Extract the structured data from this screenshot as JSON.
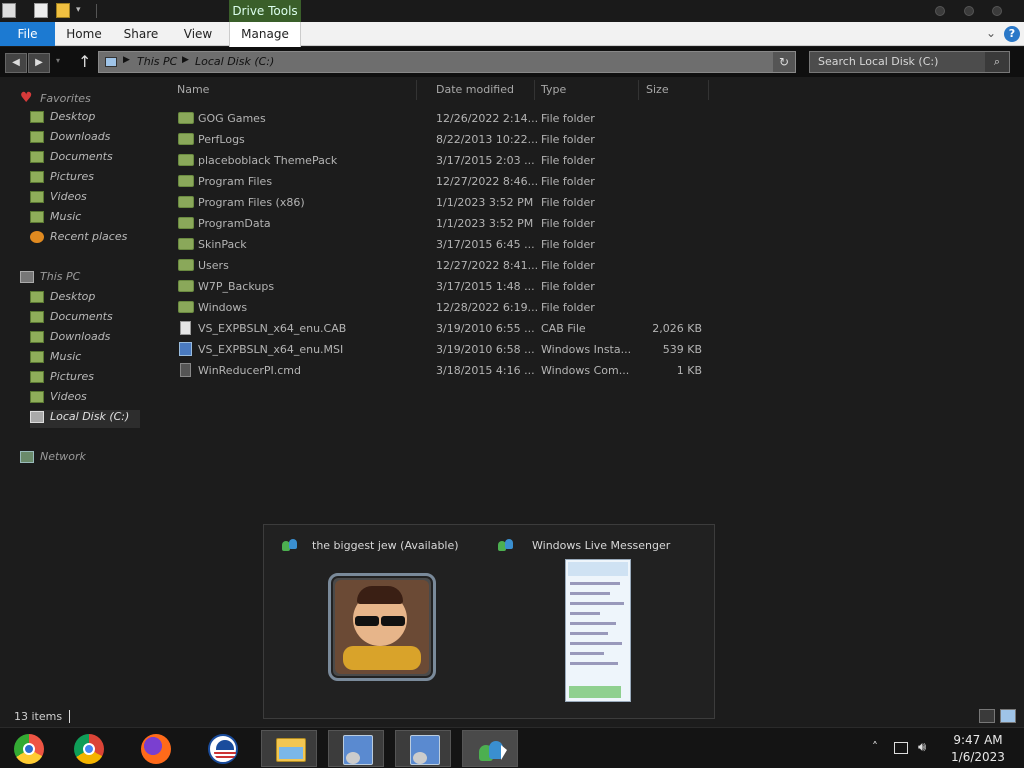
{
  "titlebar": {
    "context_tab": "Drive Tools"
  },
  "ribbon": {
    "tabs": [
      {
        "label": "File"
      },
      {
        "label": "Home"
      },
      {
        "label": "Share"
      },
      {
        "label": "View"
      },
      {
        "label": "Manage"
      }
    ],
    "help_label": "?"
  },
  "address": {
    "crumbs": [
      "This PC",
      "Local Disk (C:)"
    ]
  },
  "search": {
    "placeholder": "Search Local Disk (C:)"
  },
  "nav": {
    "favorites_label": "Favorites",
    "favorites": [
      {
        "label": "Desktop"
      },
      {
        "label": "Downloads"
      },
      {
        "label": "Documents"
      },
      {
        "label": "Pictures"
      },
      {
        "label": "Videos"
      },
      {
        "label": "Music"
      },
      {
        "label": "Recent places"
      }
    ],
    "thispc_label": "This PC",
    "thispc": [
      {
        "label": "Desktop"
      },
      {
        "label": "Documents"
      },
      {
        "label": "Downloads"
      },
      {
        "label": "Music"
      },
      {
        "label": "Pictures"
      },
      {
        "label": "Videos"
      },
      {
        "label": "Local Disk (C:)"
      }
    ],
    "network_label": "Network"
  },
  "columns": {
    "name": "Name",
    "date": "Date modified",
    "type": "Type",
    "size": "Size"
  },
  "files": [
    {
      "name": "GOG Games",
      "date": "12/26/2022 2:14...",
      "type": "File folder",
      "size": "",
      "icon": "folder"
    },
    {
      "name": "PerfLogs",
      "date": "8/22/2013 10:22...",
      "type": "File folder",
      "size": "",
      "icon": "folder"
    },
    {
      "name": "placeboblack ThemePack",
      "date": "3/17/2015 2:03 ...",
      "type": "File folder",
      "size": "",
      "icon": "folder"
    },
    {
      "name": "Program Files",
      "date": "12/27/2022 8:46...",
      "type": "File folder",
      "size": "",
      "icon": "folder"
    },
    {
      "name": "Program Files (x86)",
      "date": "1/1/2023 3:52 PM",
      "type": "File folder",
      "size": "",
      "icon": "folder"
    },
    {
      "name": "ProgramData",
      "date": "1/1/2023 3:52 PM",
      "type": "File folder",
      "size": "",
      "icon": "folder"
    },
    {
      "name": "SkinPack",
      "date": "3/17/2015 6:45 ...",
      "type": "File folder",
      "size": "",
      "icon": "folder"
    },
    {
      "name": "Users",
      "date": "12/27/2022 8:41...",
      "type": "File folder",
      "size": "",
      "icon": "folder"
    },
    {
      "name": "W7P_Backups",
      "date": "3/17/2015 1:48 ...",
      "type": "File folder",
      "size": "",
      "icon": "folder"
    },
    {
      "name": "Windows",
      "date": "12/28/2022 6:19...",
      "type": "File folder",
      "size": "",
      "icon": "folder"
    },
    {
      "name": "VS_EXPBSLN_x64_enu.CAB",
      "date": "3/19/2010 6:55 ...",
      "type": "CAB File",
      "size": "2,026 KB",
      "icon": "cab"
    },
    {
      "name": "VS_EXPBSLN_x64_enu.MSI",
      "date": "3/19/2010 6:58 ...",
      "type": "Windows Insta...",
      "size": "539 KB",
      "icon": "msi"
    },
    {
      "name": "WinReducerPI.cmd",
      "date": "3/18/2015 4:16 ...",
      "type": "Windows Com...",
      "size": "1 KB",
      "icon": "cmd"
    }
  ],
  "popup": {
    "thumb1_title": "the biggest jew (Available)",
    "thumb2_title": "Windows Live Messenger"
  },
  "status": {
    "item_count": "13 items"
  },
  "taskbar": {
    "apps": [
      {
        "icon": "chrome-canary-icon"
      },
      {
        "icon": "chrome-icon"
      },
      {
        "icon": "firefox-icon"
      },
      {
        "icon": "obama-logo-icon"
      },
      {
        "icon": "file-explorer-icon"
      },
      {
        "icon": "installer-icon"
      },
      {
        "icon": "installer-icon"
      },
      {
        "icon": "messenger-icon"
      }
    ],
    "time": "9:47 AM",
    "date": "1/6/2023"
  }
}
